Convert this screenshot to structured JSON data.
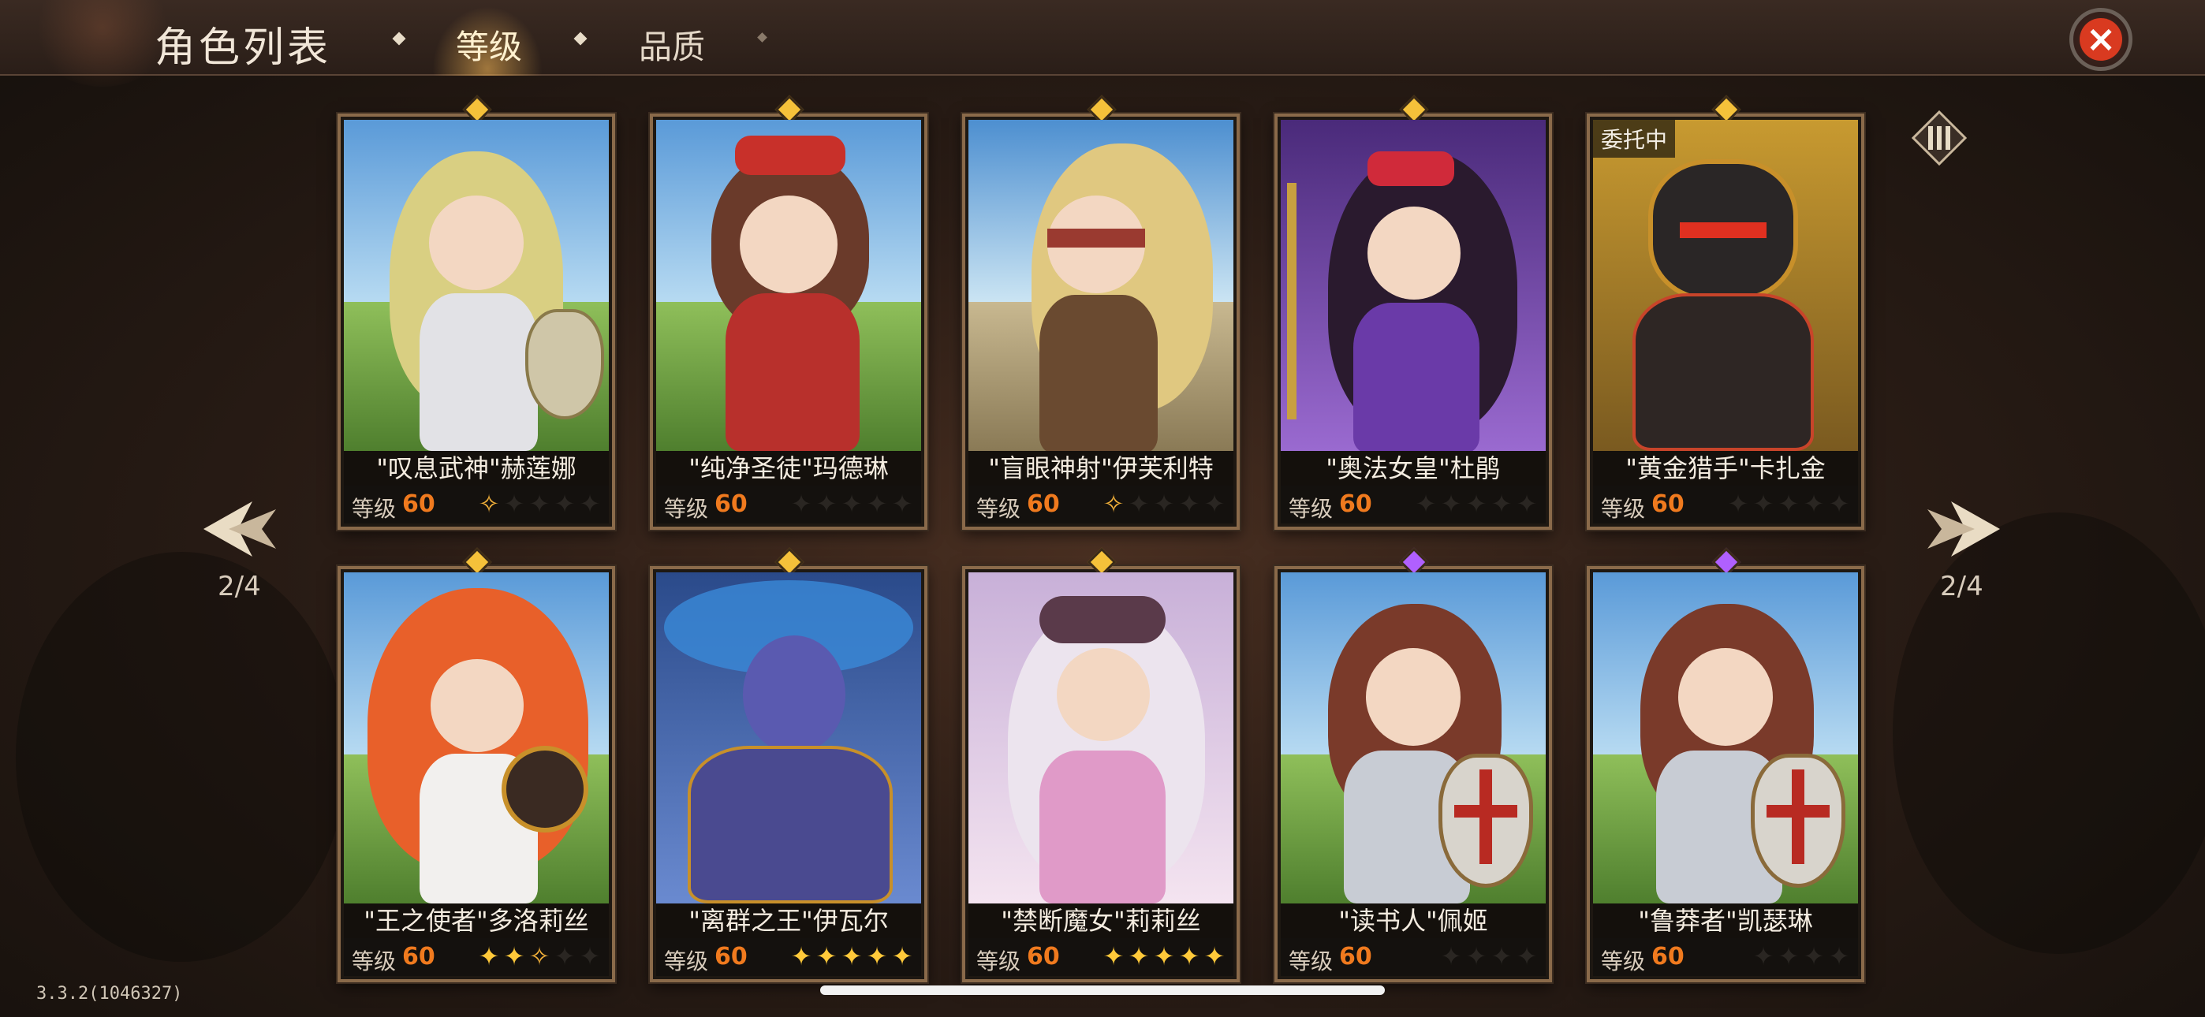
{
  "header": {
    "title": "角色列表",
    "tabs": [
      {
        "label": "等级",
        "selected": true
      },
      {
        "label": "品质",
        "selected": false
      }
    ],
    "close_icon": "close-icon"
  },
  "pagination": {
    "left_indicator": "2/4",
    "right_indicator": "2/4"
  },
  "level_label": "等级",
  "characters": [
    {
      "name": "\"叹息武神\"赫莲娜",
      "level": "60",
      "stars": [
        "half",
        "off",
        "off",
        "off",
        "off"
      ],
      "rarity": "gold"
    },
    {
      "name": "\"纯净圣徒\"玛德琳",
      "level": "60",
      "stars": [
        "off",
        "off",
        "off",
        "off",
        "off"
      ],
      "rarity": "gold"
    },
    {
      "name": "\"盲眼神射\"伊芙利特",
      "level": "60",
      "stars": [
        "half",
        "off",
        "off",
        "off",
        "off"
      ],
      "rarity": "gold"
    },
    {
      "name": "\"奥法女皇\"杜鹃",
      "level": "60",
      "stars": [
        "off",
        "off",
        "off",
        "off",
        "off"
      ],
      "rarity": "gold"
    },
    {
      "name": "\"黄金猎手\"卡扎金",
      "level": "60",
      "stars": [
        "off",
        "off",
        "off",
        "off",
        "off"
      ],
      "rarity": "gold",
      "badge": "委托中"
    },
    {
      "name": "\"王之使者\"多洛莉丝",
      "level": "60",
      "stars": [
        "on",
        "on",
        "half",
        "off",
        "off"
      ],
      "rarity": "gold"
    },
    {
      "name": "\"离群之王\"伊瓦尔",
      "level": "60",
      "stars": [
        "on",
        "on",
        "on",
        "on",
        "on"
      ],
      "rarity": "gold"
    },
    {
      "name": "\"禁断魔女\"莉莉丝",
      "level": "60",
      "stars": [
        "on",
        "on",
        "on",
        "on",
        "on"
      ],
      "rarity": "gold"
    },
    {
      "name": "\"读书人\"佩姬",
      "level": "60",
      "stars": [
        "off",
        "off",
        "off",
        "off"
      ],
      "rarity": "purple"
    },
    {
      "name": "\"鲁莽者\"凯瑟琳",
      "level": "60",
      "stars": [
        "off",
        "off",
        "off",
        "off"
      ],
      "rarity": "purple"
    }
  ],
  "colors": {
    "accent_gold": "#f5c13a",
    "rarity_purple": "#b060ff",
    "level_orange": "#f07a1e",
    "close_red": "#d93a20"
  },
  "footer": {
    "version": "3.3.2(1046327)"
  }
}
